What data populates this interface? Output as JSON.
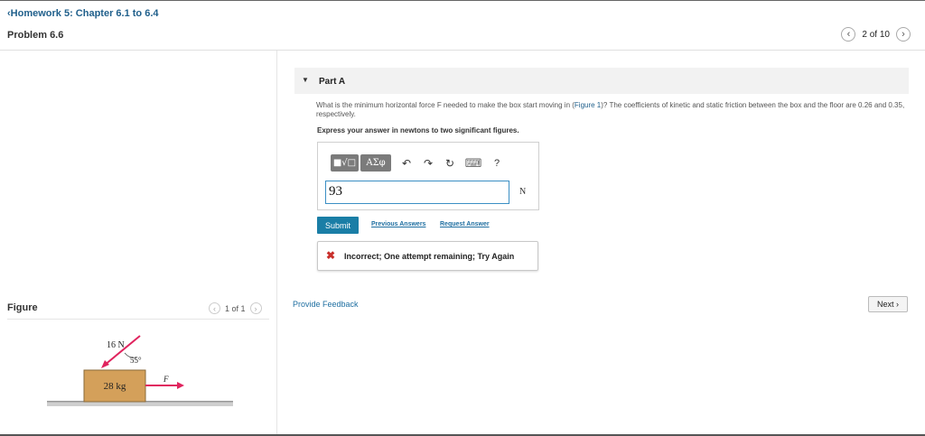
{
  "header": {
    "back_link": "‹Homework 5: Chapter 6.1 to 6.4",
    "problem_title": "Problem 6.6",
    "pager_text": "2 of 10"
  },
  "figure_panel": {
    "label": "Figure",
    "pager_text": "1 of 1",
    "diagram": {
      "force_label": "16 N",
      "angle_label": "55°",
      "mass_label": "28 kg",
      "f_label": "F"
    }
  },
  "part": {
    "title": "Part A",
    "question_part1": "What is the minimum horizontal force F needed to make the box start moving in (",
    "figure_link": "Figure 1",
    "question_part2": ")? The coefficients of kinetic and static friction between the box and the floor are 0.26 and 0.35, respectively.",
    "instructions": "Express your answer in newtons to two significant figures."
  },
  "toolbar": {
    "template_label": "■√□",
    "greek_label": "AΣφ",
    "undo_label": "↶",
    "redo_label": "↷",
    "reset_label": "↻",
    "keyboard_label": "⌨",
    "help_label": "?"
  },
  "answer": {
    "value": "93",
    "unit": "N"
  },
  "actions": {
    "submit": "Submit",
    "previous_answers": "Previous Answers",
    "request_answer": "Request Answer"
  },
  "feedback": {
    "icon": "✖",
    "message": "Incorrect; One attempt remaining; Try Again"
  },
  "footer": {
    "provide_feedback": "Provide Feedback",
    "next": "Next ›"
  },
  "colors": {
    "link": "#1f6fa1",
    "submit": "#1a7ea6",
    "error": "#c9302c",
    "box_fill": "#d4a05a",
    "arrow": "#e0245e"
  }
}
